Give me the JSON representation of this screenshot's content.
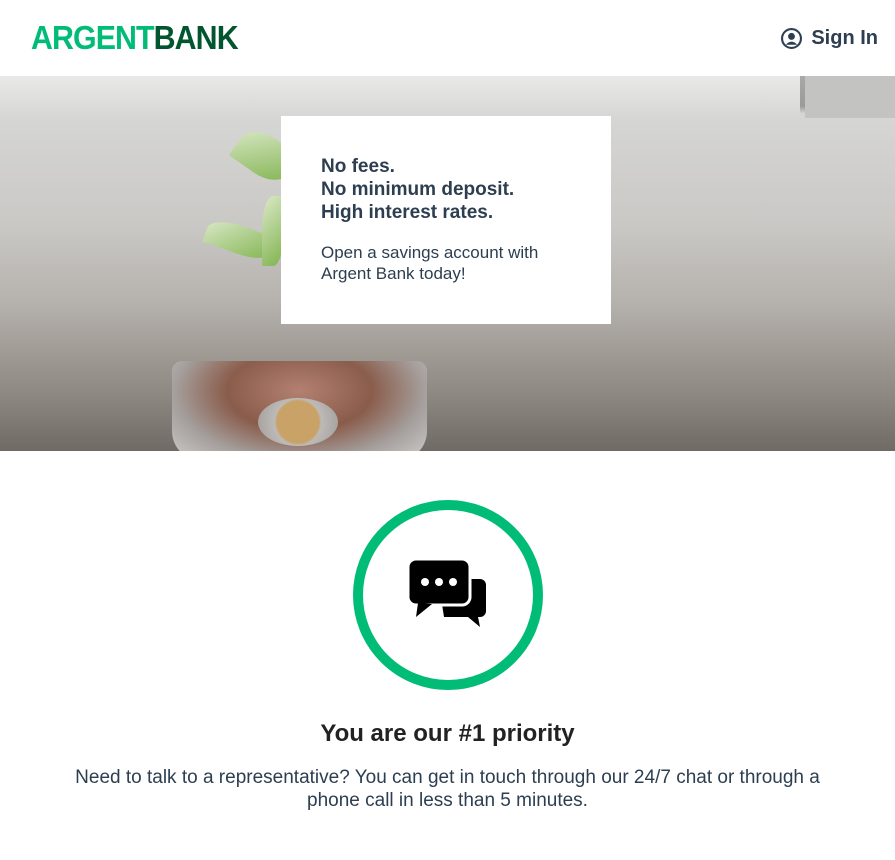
{
  "header": {
    "logo_part1": "ARGENT",
    "logo_part2": "BANK",
    "signin_label": "Sign In"
  },
  "hero": {
    "subtitles": [
      "No fees.",
      "No minimum deposit.",
      "High interest rates."
    ],
    "text": "Open a savings account with Argent Bank today!"
  },
  "feature": {
    "icon": "chat-bubbles-icon",
    "title": "You are our #1 priority",
    "text": "Need to talk to a representative? You can get in touch through our 24/7 chat or through a phone call in less than 5 minutes."
  },
  "colors": {
    "accent": "#00bc77",
    "logo_dark": "#02562f",
    "text": "#2c3e50"
  }
}
